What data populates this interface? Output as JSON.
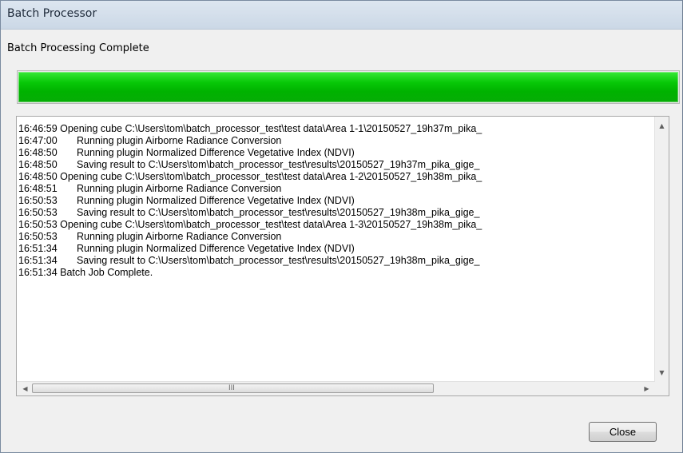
{
  "window": {
    "title": "Batch Processor"
  },
  "status": {
    "message": "Batch Processing Complete",
    "progress_percent": 100
  },
  "log": {
    "lines": [
      "16:46:59 Opening cube C:\\Users\\tom\\batch_processor_test\\test data\\Area 1-1\\20150527_19h37m_pika_",
      "16:47:00       Running plugin Airborne Radiance Conversion",
      "16:48:50       Running plugin Normalized Difference Vegetative Index (NDVI)",
      "16:48:50       Saving result to C:\\Users\\tom\\batch_processor_test\\results\\20150527_19h37m_pika_gige_",
      "16:48:50 Opening cube C:\\Users\\tom\\batch_processor_test\\test data\\Area 1-2\\20150527_19h38m_pika_",
      "16:48:51       Running plugin Airborne Radiance Conversion",
      "16:50:53       Running plugin Normalized Difference Vegetative Index (NDVI)",
      "16:50:53       Saving result to C:\\Users\\tom\\batch_processor_test\\results\\20150527_19h38m_pika_gige_",
      "16:50:53 Opening cube C:\\Users\\tom\\batch_processor_test\\test data\\Area 1-3\\20150527_19h38m_pika_",
      "16:50:53       Running plugin Airborne Radiance Conversion",
      "16:51:34       Running plugin Normalized Difference Vegetative Index (NDVI)",
      "16:51:34       Saving result to C:\\Users\\tom\\batch_processor_test\\results\\20150527_19h38m_pika_gige_",
      "16:51:34 Batch Job Complete."
    ]
  },
  "scrollbar": {
    "up_icon": "chevron-up-icon",
    "down_icon": "chevron-down-icon",
    "left_icon": "chevron-left-icon",
    "right_icon": "chevron-right-icon",
    "grip": "III"
  },
  "buttons": {
    "close_label": "Close"
  },
  "colors": {
    "progress": "#00b200",
    "titlebar": "#cbd8e6"
  }
}
